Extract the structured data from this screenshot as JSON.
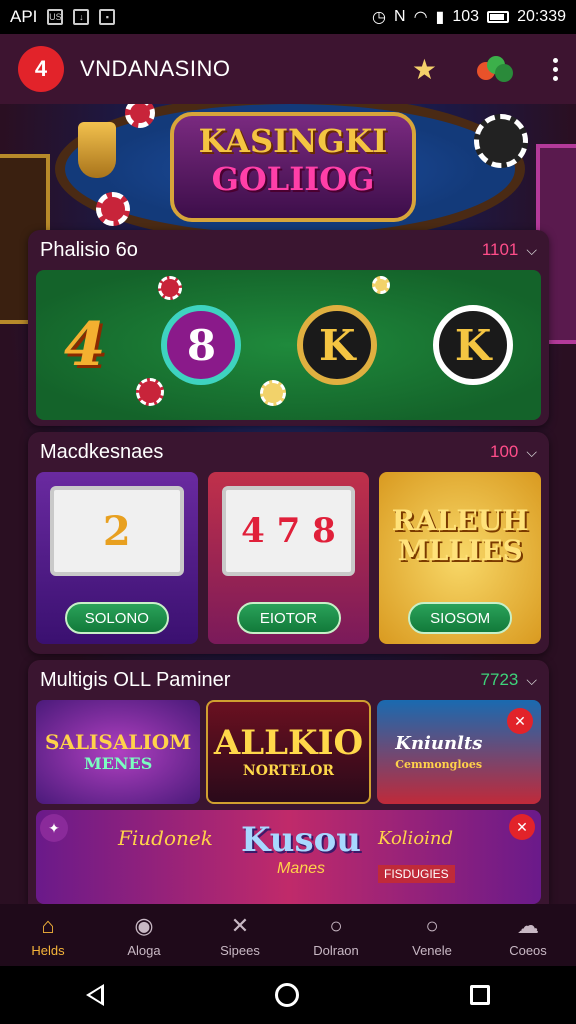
{
  "status_bar": {
    "left_label": "API",
    "box1": "US",
    "right_time": "20:339",
    "signal_text": "103"
  },
  "app_bar": {
    "logo_glyph": "4",
    "title": "VNDANASINO"
  },
  "banner": {
    "line1": "KASINGKI",
    "line2": "GOLIIOG"
  },
  "section1": {
    "title": "Phalisio 6o",
    "count": "1101",
    "count_color": "#ff4d8a",
    "tile1": "4",
    "tile2": "8",
    "tile3": "K",
    "tile4": "K"
  },
  "section2": {
    "title": "Macdkesnaes",
    "count": "100",
    "count_color": "#ff4d8a",
    "cards": [
      {
        "reel": "2",
        "button": "SOLONO"
      },
      {
        "reel": "4 7 8",
        "reel2": "7",
        "button": "EIOTOR"
      },
      {
        "line1": "RALEUH",
        "line2": "MLLIES",
        "button": "SIOSOM"
      }
    ]
  },
  "section3": {
    "title": "Multigis OLL Paminer",
    "count": "7723",
    "count_color": "#3ed37a",
    "promos": [
      {
        "line1": "SALISALIOM",
        "line2": "MENES"
      },
      {
        "line1": "ALLKIO",
        "line2": "NORTELOR"
      },
      {
        "line1": "Kniunlts",
        "line2": "Cemmongloes"
      }
    ],
    "wide": {
      "left": "Fiudonek",
      "center1": "Kusou",
      "center2": "Manes",
      "right1": "Kolioind",
      "right2": "FISDUGIES"
    }
  },
  "bottom_nav": [
    {
      "icon": "home-icon",
      "label": "Helds",
      "active": true
    },
    {
      "icon": "avatar-icon",
      "label": "Aloga",
      "active": false
    },
    {
      "icon": "crossed-tools-icon",
      "label": "Sipees",
      "active": false
    },
    {
      "icon": "search-icon",
      "label": "Dolraon",
      "active": false
    },
    {
      "icon": "search-icon",
      "label": "Venele",
      "active": false
    },
    {
      "icon": "cloud-icon",
      "label": "Coeos",
      "active": false
    }
  ],
  "colors": {
    "accent": "#f5b43a",
    "brand_red": "#e2232a",
    "card_bg": "#3a1530",
    "appbar": "#3d1430"
  }
}
